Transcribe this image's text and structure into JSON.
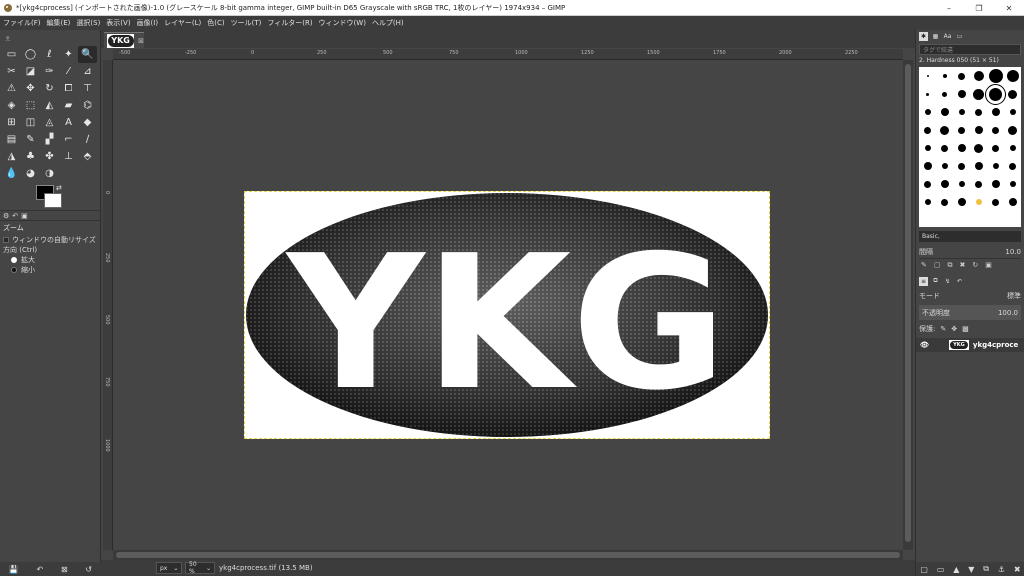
{
  "window": {
    "title": "*[ykg4cprocess] (インポートされた画像)-1.0 (グレースケール 8-bit gamma integer, GIMP built-in D65 Grayscale with sRGB TRC, 1枚のレイヤー) 1974x934 – GIMP",
    "minimize": "–",
    "maximize": "❐",
    "close": "✕"
  },
  "menu": [
    "ファイル(F)",
    "編集(E)",
    "選択(S)",
    "表示(V)",
    "画像(I)",
    "レイヤー(L)",
    "色(C)",
    "ツール(T)",
    "フィルター(R)",
    "ウィンドウ(W)",
    "ヘルプ(H)"
  ],
  "toolbox": {
    "tools": [
      {
        "name": "rect-select-tool",
        "glyph": "▭"
      },
      {
        "name": "ellipse-select-tool",
        "glyph": "◯"
      },
      {
        "name": "free-select-tool",
        "glyph": "ℓ"
      },
      {
        "name": "fuzzy-select-tool",
        "glyph": "✦"
      },
      {
        "name": "zoom-tool",
        "glyph": "🔍",
        "active": true
      },
      {
        "name": "crop-tool",
        "glyph": "✂"
      },
      {
        "name": "foreground-select-tool",
        "glyph": "◪"
      },
      {
        "name": "paths-tool",
        "glyph": "✑"
      },
      {
        "name": "color-picker-tool",
        "glyph": "⁄"
      },
      {
        "name": "measure-tool",
        "glyph": "⊿"
      },
      {
        "name": "align-tool",
        "glyph": "⚠"
      },
      {
        "name": "move-tool",
        "glyph": "✥"
      },
      {
        "name": "rotate-tool",
        "glyph": "↻"
      },
      {
        "name": "crop-canvas-tool",
        "glyph": "⧠"
      },
      {
        "name": "transform-tool",
        "glyph": "⊤"
      },
      {
        "name": "warp-tool",
        "glyph": "◈"
      },
      {
        "name": "flip-tool",
        "glyph": "⬚"
      },
      {
        "name": "perspective-tool",
        "glyph": "◭"
      },
      {
        "name": "unified-transform-tool",
        "glyph": "▰"
      },
      {
        "name": "cage-tool",
        "glyph": "⌬"
      },
      {
        "name": "handle-transform-tool",
        "glyph": "⊞"
      },
      {
        "name": "text-tool",
        "glyph": "◫"
      },
      {
        "name": "blend-tool",
        "glyph": "◬"
      },
      {
        "name": "a-text-tool",
        "glyph": "A"
      },
      {
        "name": "bucket-fill-tool",
        "glyph": "◆"
      },
      {
        "name": "gradient-tool",
        "glyph": "▤"
      },
      {
        "name": "paintbrush-tool",
        "glyph": "✎"
      },
      {
        "name": "pencil-tool",
        "glyph": "▞"
      },
      {
        "name": "airbrush-tool",
        "glyph": "⌐"
      },
      {
        "name": "eraser-tool",
        "glyph": "∕"
      },
      {
        "name": "ink-tool",
        "glyph": "◮"
      },
      {
        "name": "mypaint-tool",
        "glyph": "♣"
      },
      {
        "name": "clone-tool",
        "glyph": "✤"
      },
      {
        "name": "heal-tool",
        "glyph": "⊥"
      },
      {
        "name": "perspective-clone-tool",
        "glyph": "⬘"
      },
      {
        "name": "blur-tool",
        "glyph": "💧"
      },
      {
        "name": "smudge-tool",
        "glyph": "◕"
      },
      {
        "name": "dodge-tool",
        "glyph": "◑"
      }
    ],
    "options": {
      "title": "ズーム",
      "auto_resize": "ウィンドウの自動リサイズ",
      "direction_label": "方向 (Ctrl)",
      "zoom_in": "拡大",
      "zoom_out": "縮小"
    }
  },
  "document": {
    "tab_thumb": "YKG",
    "ruler_labels": [
      "-500",
      "-250",
      "0",
      "250",
      "500",
      "750",
      "1000",
      "1250",
      "1500",
      "1750",
      "2000",
      "2250"
    ],
    "vruler_labels": [
      "0",
      "250",
      "500",
      "750",
      "1000"
    ],
    "image_text": "YKG",
    "status": {
      "unit": "px",
      "zoom": "50 %",
      "info": "ykg4cprocess.tif (13.5 MB)"
    }
  },
  "dock": {
    "tag_placeholder": "タグで絞違",
    "brush_name": "2. Hardness 050 (51 × 51)",
    "preset": "Basic,",
    "spacing_label": "間隔",
    "spacing_value": "10.0",
    "mode_label": "モード",
    "mode_value": "標準",
    "opacity_label": "不透明度",
    "opacity_value": "100.0",
    "lock_label": "保護:",
    "layer_name": "ykg4cproce",
    "layer_thumb": "YKG"
  }
}
